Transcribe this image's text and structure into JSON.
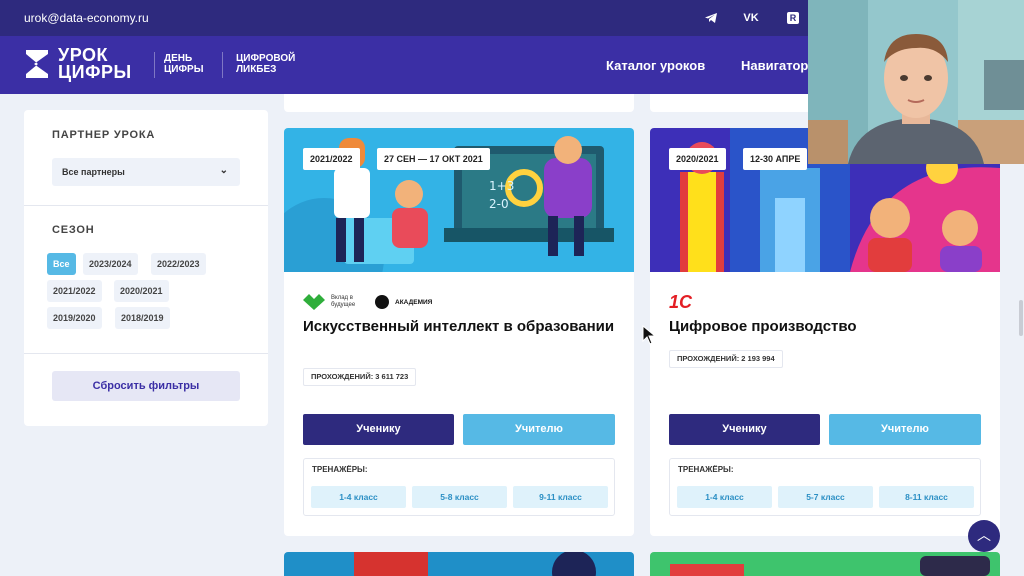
{
  "topbar": {
    "email": "urok@data-economy.ru",
    "socials": [
      "telegram-icon",
      "vk-icon",
      "rutube-icon"
    ]
  },
  "nav": {
    "logo_line1": "УРОК",
    "logo_line2": "ЦИФРЫ",
    "partner1_line1": "ДЕНЬ",
    "partner1_line2": "ЦИФРЫ",
    "partner2_line1": "ЦИФРОВОЙ",
    "partner2_line2": "ЛИКБЕЗ",
    "links": [
      "Каталог уроков",
      "Навигатор"
    ]
  },
  "sidebar": {
    "partner_title": "ПАРТНЕР УРОКА",
    "partner_select": "Все партнеры",
    "season_title": "СЕЗОН",
    "seasons": [
      "Все",
      "2023/2024",
      "2022/2023",
      "2021/2022",
      "2020/2021",
      "2019/2020",
      "2018/2019"
    ],
    "active_season": "Все",
    "reset_label": "Сбросить фильтры"
  },
  "cards": [
    {
      "season": "2021/2022",
      "dates": "27 СЕН — 17 ОКТ 2021",
      "partner_logo1": "Вклад в будущее",
      "partner_logo2": "АКАДЕМИЯ",
      "title": "Искусственный интеллект в образовании",
      "passes": "ПРОХОЖДЕНИЙ: 3 611 723",
      "student_label": "Ученику",
      "teacher_label": "Учителю",
      "trainers_label": "ТРЕНАЖЁРЫ:",
      "grades": [
        "1-4 класс",
        "5-8 класс",
        "9-11 класс"
      ]
    },
    {
      "season": "2020/2021",
      "dates": "12-30 АПРЕ",
      "partner_logo1": "1С",
      "title": "Цифровое производство",
      "passes": "ПРОХОЖДЕНИЙ: 2 193 994",
      "student_label": "Ученику",
      "teacher_label": "Учителю",
      "trainers_label": "ТРЕНАЖЁРЫ:",
      "grades": [
        "1-4 класс",
        "5-7 класс",
        "8-11 класс"
      ]
    }
  ],
  "colors": {
    "topbar": "#2e2a7e",
    "navbar": "#3b2fa5",
    "accent": "#56b9e5",
    "primary": "#2e2a7e"
  }
}
